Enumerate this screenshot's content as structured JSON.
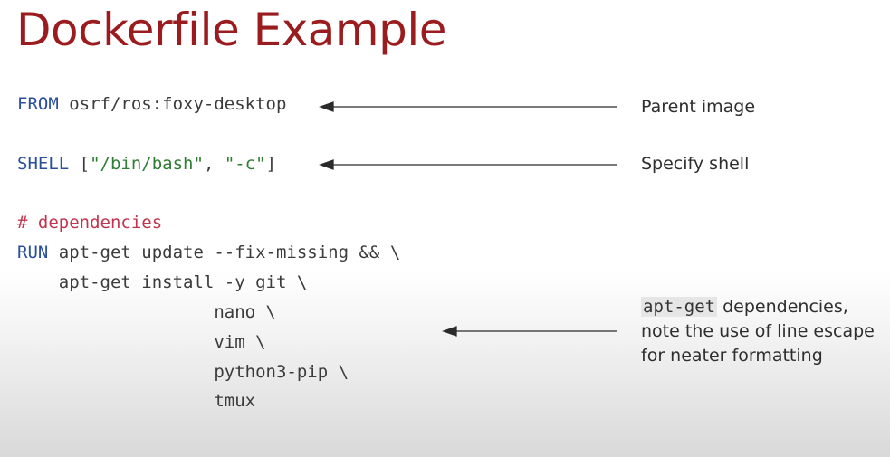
{
  "slide": {
    "title": "Dockerfile Example"
  },
  "code": {
    "line1": {
      "keyword": "FROM",
      "rest": " osrf/ros:foxy-desktop"
    },
    "line2": {
      "keyword": "SHELL",
      "open": " [",
      "str1": "\"/bin/bash\"",
      "sep": ", ",
      "str2": "\"-c\"",
      "close": "]"
    },
    "line3": {
      "comment": "# dependencies"
    },
    "line4": {
      "keyword": "RUN",
      "rest": " apt-get update --fix-missing && \\"
    },
    "line5": "    apt-get install -y git \\",
    "line6": "                   nano \\",
    "line7": "                   vim \\",
    "line8": "                   python3-pip \\",
    "line9": "                   tmux"
  },
  "annotations": {
    "parent_image": "Parent image",
    "specify_shell": "Specify shell",
    "deps_code": "apt-get",
    "deps_line1_rest": " dependencies,",
    "deps_line2": "note the use of line escape",
    "deps_line3": "for neater formatting"
  },
  "colors": {
    "title": "#9b1c1f",
    "keyword": "#2a4f9b",
    "string": "#2e7d32",
    "comment": "#c2334e"
  }
}
